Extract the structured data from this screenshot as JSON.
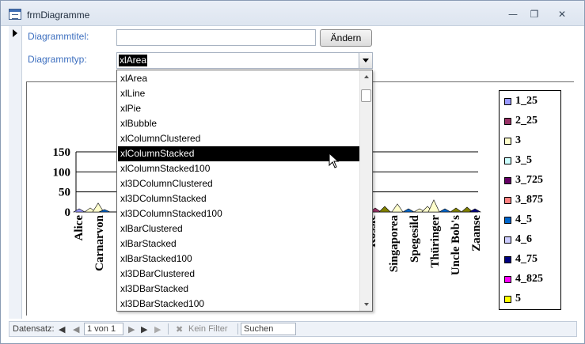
{
  "window": {
    "title": "frmDiagramme"
  },
  "form": {
    "chart_title_label": "Diagrammtitel:",
    "chart_title_value": "",
    "change_button": "Ändern",
    "chart_type_label": "Diagrammtyp:",
    "chart_type_value": "xlArea"
  },
  "dropdown": {
    "items": [
      "xlArea",
      "xlLine",
      "xlPie",
      "xlBubble",
      "xlColumnClustered",
      "xlColumnStacked",
      "xlColumnStacked100",
      "xl3DColumnClustered",
      "xl3DColumnStacked",
      "xl3DColumnStacked100",
      "xlBarClustered",
      "xlBarStacked",
      "xlBarStacked100",
      "xl3DBarClustered",
      "xl3DBarStacked",
      "xl3DBarStacked100"
    ],
    "highlighted": "xlColumnStacked"
  },
  "chart_data": {
    "type": "area",
    "yticks": [
      "150",
      "100",
      "50",
      "0"
    ],
    "ylim": [
      0,
      150
    ],
    "visible_categories_left": [
      "Alice",
      "Carnarvon"
    ],
    "visible_categories_right": [
      "Rössle",
      "Singaporea",
      "Spegesild",
      "Thüringer",
      "Uncle Bob's",
      "Zaanse"
    ],
    "legend": [
      {
        "label": "1_25",
        "color": "#9999ff"
      },
      {
        "label": "2_25",
        "color": "#993366"
      },
      {
        "label": "3",
        "color": "#ffffcc"
      },
      {
        "label": "3_5",
        "color": "#ccffff"
      },
      {
        "label": "3_725",
        "color": "#660066"
      },
      {
        "label": "3_875",
        "color": "#ff8080"
      },
      {
        "label": "4_5",
        "color": "#0066cc"
      },
      {
        "label": "4_6",
        "color": "#ccccff"
      },
      {
        "label": "4_75",
        "color": "#000080"
      },
      {
        "label": "4_825",
        "color": "#ff00ff"
      },
      {
        "label": "5",
        "color": "#ffff00"
      }
    ]
  },
  "navigation": {
    "record_label": "Datensatz:",
    "record_position": "1 von 1",
    "filter_label": "Kein Filter",
    "search_label": "Suchen"
  }
}
